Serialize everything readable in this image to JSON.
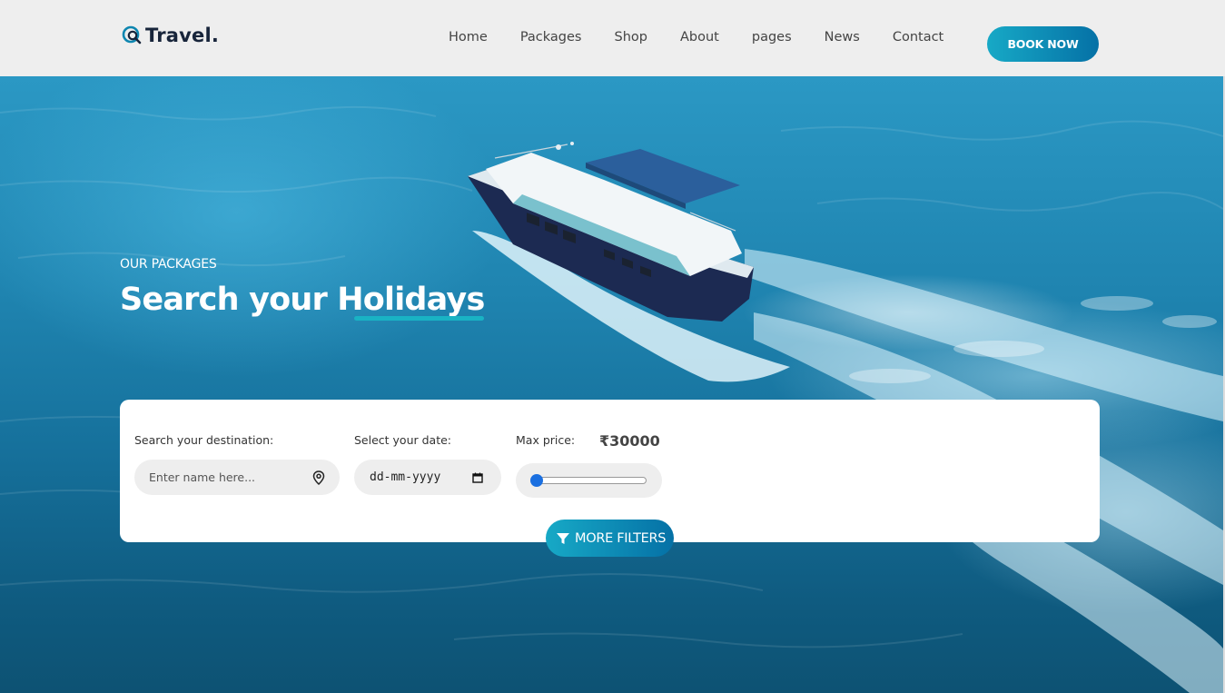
{
  "header": {
    "logo_text": "Travel.",
    "nav": [
      "Home",
      "Packages",
      "Shop",
      "About",
      "pages",
      "News",
      "Contact"
    ],
    "book_now": "BOOK NOW"
  },
  "hero": {
    "eyebrow": "OUR PACKAGES",
    "headline": "Search your Holidays"
  },
  "search": {
    "destination_label": "Search your destination:",
    "destination_placeholder": "Enter name here...",
    "date_label": "Select your date:",
    "date_placeholder": "dd-mm-yyyy",
    "price_label": "Max price:",
    "price_value": "₹30000",
    "slider_level": 0,
    "more_filters": "MORE FILTERS"
  },
  "colors": {
    "accent_start": "#17a9c6",
    "accent_end": "#0571a6",
    "underline": "#19b3c4",
    "logo": "#17243a"
  },
  "icons": [
    "search-globe-icon",
    "location-pin-icon",
    "calendar-icon",
    "filter-icon"
  ]
}
